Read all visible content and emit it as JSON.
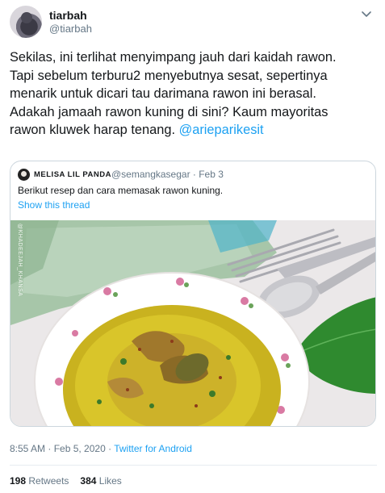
{
  "author": {
    "name": "tiarbah",
    "handle": "@tiarbah"
  },
  "tweet": {
    "text": "Sekilas, ini terlihat menyimpang jauh dari kaidah rawon.\nTapi sebelum terburu2 menyebutnya sesat, sepertinya\nmenarik untuk dicari tau darimana rawon ini berasal.\nAdakah jamaah rawon kuning di sini?  Kaum mayoritas\nrawon kluwek harap tenang. ",
    "mention": "@arieparikesit"
  },
  "quoted": {
    "name": "MELISA LIL PANDA",
    "meta": "@semangkasegar · Feb 3",
    "text": "Berikut resep dan cara memasak rawon kuning.",
    "show_thread": "Show this thread",
    "watermark": "@KHADEEJAH_KHANSA"
  },
  "timestamp": {
    "time": "8:55 AM · Feb 5, 2020 · ",
    "client": "Twitter for Android"
  },
  "stats": {
    "retweets_count": "198",
    "retweets_label": "Retweets",
    "likes_count": "384",
    "likes_label": "Likes"
  },
  "icons": {
    "caret": "chevron-down-icon"
  },
  "colors": {
    "link": "#1da1f2",
    "secondary_text": "#657786",
    "border": "#ccd6dd"
  }
}
